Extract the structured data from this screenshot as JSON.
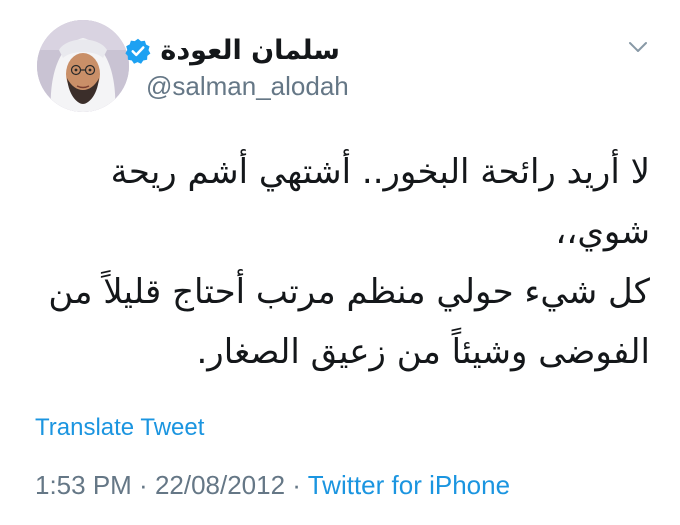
{
  "tweet": {
    "author": {
      "display_name": "سلمان العودة",
      "handle": "@salman_alodah",
      "verified": true,
      "avatar_icon": "profile-photo"
    },
    "lines": [
      "لا أريد رائحة البخور.. أشتهي أشم ريحة",
      "شوي،،",
      "كل شيء حولي منظم مرتب أحتاج قليلاً من",
      "الفوضى وشيئاً من زعيق الصغار."
    ],
    "translate_label": "Translate Tweet",
    "time": "1:53 PM",
    "separator": " · ",
    "date": "22/08/2012",
    "source": "Twitter for iPhone"
  },
  "menu_icon": "chevron-down-icon",
  "colors": {
    "link": "#1b95e0",
    "muted": "#657786",
    "text": "#14171a",
    "verified": "#1da1f2"
  }
}
